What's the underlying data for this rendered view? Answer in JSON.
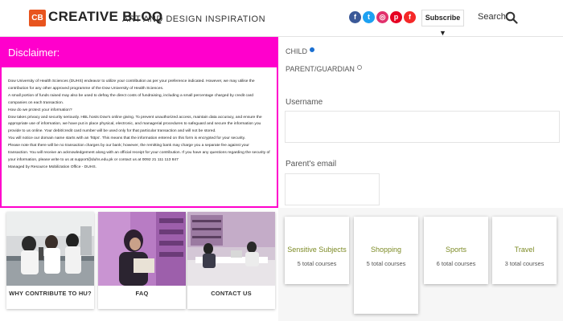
{
  "header": {
    "logo_badge": "CB",
    "logo_text": "CREATIVE BLOQ",
    "tagline": "ART AND DESIGN INSPIRATION",
    "social": [
      {
        "name": "facebook",
        "glyph": "f",
        "color": "#3b5998"
      },
      {
        "name": "twitter",
        "glyph": "t",
        "color": "#1da1f2"
      },
      {
        "name": "instagram",
        "glyph": "◎",
        "color": "#e1306c"
      },
      {
        "name": "pinterest",
        "glyph": "p",
        "color": "#e60023"
      },
      {
        "name": "flipboard",
        "glyph": "f",
        "color": "#f52828"
      }
    ],
    "subscribe_label": "Subscribe ▼",
    "search_label": "Search"
  },
  "disclaimer": {
    "title": "Disclaimer:",
    "lines": [
      "Dow University of Health Sciences (DUHS) endeavor to utilize your contribution as per your preference indicated. However, we may utilise the contribution for any other approved programme of the Dow University of Health Sciences.",
      "A small portion of funds raised may also be used to defray the direct costs of fundraising, including a small percentage charged by credit card companies on each transaction.",
      "How do we protect your information?",
      "Dow takes privacy and security seriously. HBL hosts Dow's online giving. To prevent unauthorized access, maintain data accuracy, and ensure the appropriate use of information, we have put in place physical, electronic, and managerial procedures to safeguard and secure the information you provide to us online. Your debit/credit card number will be used only for that particular transaction and will not be stored.",
      "You will notice our domain name starts with an 'https'. This means that the information entered on this form is encrypted for your security.",
      "Please note that there will be no transaction charges by our bank; however, the remitting bank may charge you a separate fee against your transaction. You will receive an acknowledgement along with an official receipt for your contribution. If you have any questions regarding the security of your information, please write to us at support@duhs.edu.pk or contact us at 0092 21 111 113 847",
      "Managed by Resource Mobilization Office - DUHS."
    ]
  },
  "cards": [
    {
      "label": "WHY CONTRIBUTE TO HU?"
    },
    {
      "label": "FAQ"
    },
    {
      "label": "CONTACT US"
    }
  ],
  "form": {
    "radio_child": "CHILD",
    "radio_parent": "PARENT/GUARDIAN",
    "username_label": "Username",
    "parent_email_label": "Parent's email"
  },
  "tiles": [
    {
      "title": "Sensitive Subjects",
      "count": "5 total courses"
    },
    {
      "title": "Shopping",
      "count": "5 total courses"
    },
    {
      "title": "Sports",
      "count": "6 total courses"
    },
    {
      "title": "Travel",
      "count": "3 total courses"
    }
  ]
}
